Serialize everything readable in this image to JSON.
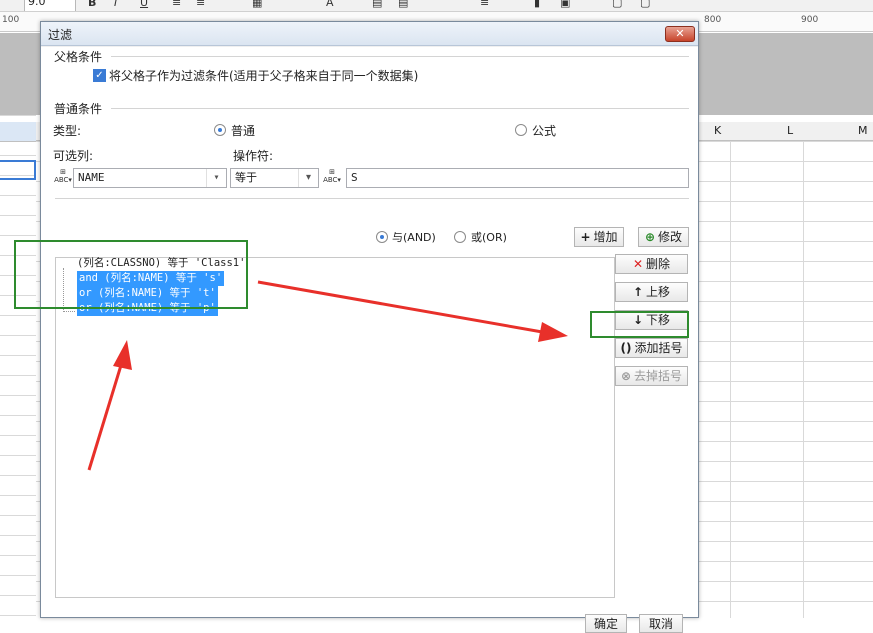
{
  "toolbar": {
    "font_size": "9.0"
  },
  "ruler": {
    "labels": [
      "100",
      "800",
      "900"
    ]
  },
  "columns": [
    "K",
    "L",
    "M"
  ],
  "dialog": {
    "title": "过滤",
    "parent_section": {
      "label": "父格条件",
      "checkbox_label": "将父格子作为过滤条件(适用于父子格来自于同一个数据集)",
      "checked": true
    },
    "normal_section": {
      "label": "普通条件",
      "type_label": "类型:",
      "type_options": [
        "普通",
        "公式"
      ],
      "type_selected": "普通",
      "column_label": "可选列:",
      "column_value": "NAME",
      "operator_label": "操作符:",
      "operator_value": "等于",
      "value_text": "S"
    },
    "logic": {
      "options": [
        "与(AND)",
        "或(OR)"
      ],
      "selected": "与(AND)"
    },
    "buttons": {
      "add": "增加",
      "modify": "修改",
      "delete": "删除",
      "move_up": "上移",
      "move_down": "下移",
      "add_paren": "添加括号",
      "remove_paren": "去掉括号",
      "ok": "确定",
      "cancel": "取消"
    },
    "conditions": [
      {
        "text": "(列名:CLASSNO) 等于 'Class1'",
        "selected": false
      },
      {
        "text": "and (列名:NAME) 等于 's'",
        "selected": true
      },
      {
        "text": "or  (列名:NAME) 等于 't'",
        "selected": true
      },
      {
        "text": "or  (列名:NAME) 等于 'p'",
        "selected": true
      }
    ]
  },
  "colors": {
    "annotation_green": "#2e8b2e",
    "annotation_red": "#e8302a",
    "selection_blue": "#3399ff"
  }
}
